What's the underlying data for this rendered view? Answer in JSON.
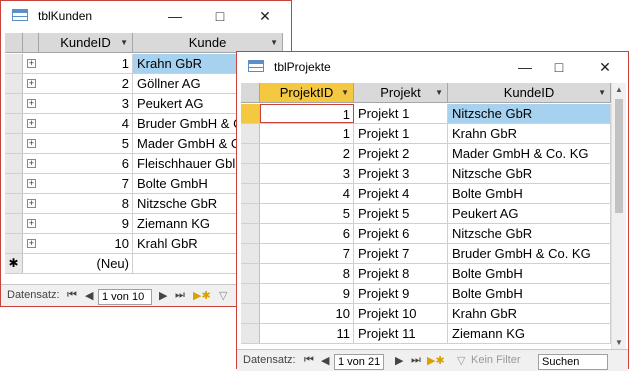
{
  "kunden": {
    "title": "tblKunden",
    "columns": [
      "KundeID",
      "Kunde"
    ],
    "rows": [
      {
        "id": "1",
        "name": "Krahn GbR"
      },
      {
        "id": "2",
        "name": "Göllner AG"
      },
      {
        "id": "3",
        "name": "Peukert AG"
      },
      {
        "id": "4",
        "name": "Bruder GmbH & C"
      },
      {
        "id": "5",
        "name": "Mader GmbH & C"
      },
      {
        "id": "6",
        "name": "Fleischhauer Gbl"
      },
      {
        "id": "7",
        "name": "Bolte GmbH"
      },
      {
        "id": "8",
        "name": "Nitzsche GbR"
      },
      {
        "id": "9",
        "name": "Ziemann KG"
      },
      {
        "id": "10",
        "name": "Krahl GbR"
      }
    ],
    "new_row_label": "(Neu)",
    "nav": {
      "label": "Datensatz:",
      "position": "1 von 10"
    }
  },
  "projekte": {
    "title": "tblProjekte",
    "columns": [
      "ProjektID",
      "Projekt",
      "KundeID"
    ],
    "rows": [
      {
        "id": "1",
        "projekt": "Projekt 1",
        "kunde": "Nitzsche GbR"
      },
      {
        "id": "1",
        "projekt": "Projekt 1",
        "kunde": "Krahn GbR"
      },
      {
        "id": "2",
        "projekt": "Projekt 2",
        "kunde": "Mader GmbH & Co. KG"
      },
      {
        "id": "3",
        "projekt": "Projekt 3",
        "kunde": "Nitzsche GbR"
      },
      {
        "id": "4",
        "projekt": "Projekt 4",
        "kunde": "Bolte GmbH"
      },
      {
        "id": "5",
        "projekt": "Projekt 5",
        "kunde": "Peukert AG"
      },
      {
        "id": "6",
        "projekt": "Projekt 6",
        "kunde": "Nitzsche GbR"
      },
      {
        "id": "7",
        "projekt": "Projekt 7",
        "kunde": "Bruder GmbH & Co. KG"
      },
      {
        "id": "8",
        "projekt": "Projekt 8",
        "kunde": "Bolte GmbH"
      },
      {
        "id": "9",
        "projekt": "Projekt 9",
        "kunde": "Bolte GmbH"
      },
      {
        "id": "10",
        "projekt": "Projekt 10",
        "kunde": "Krahn GbR"
      },
      {
        "id": "11",
        "projekt": "Projekt 11",
        "kunde": "Ziemann KG"
      }
    ],
    "nav": {
      "label": "Datensatz:",
      "position": "1 von 21",
      "filter": "Kein Filter",
      "search": "Suchen"
    }
  },
  "colors": {
    "accent_border": "#c8413a",
    "selected_header": "#f5c842",
    "highlight": "#a6d2f0"
  }
}
